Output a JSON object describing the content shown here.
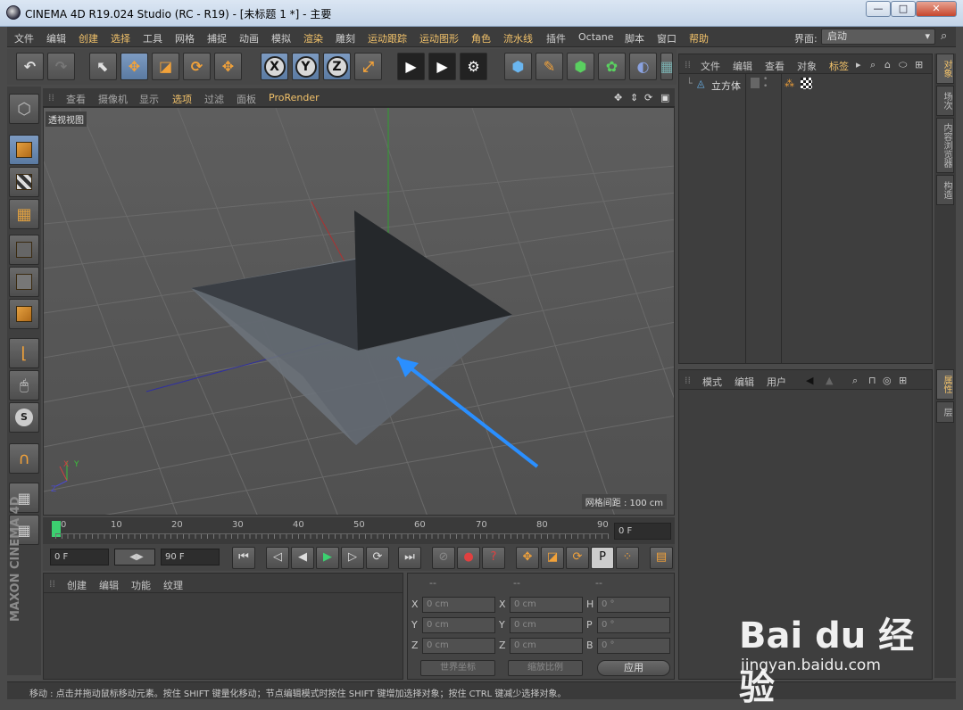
{
  "window": {
    "title": "CINEMA 4D R19.024 Studio (RC - R19) - [未标题 1 *] - 主要",
    "btn_min": "—",
    "btn_max": "□",
    "btn_close": "✕"
  },
  "menubar": {
    "items": [
      "文件",
      "编辑",
      "创建",
      "选择",
      "工具",
      "网格",
      "捕捉",
      "动画",
      "模拟",
      "渲染",
      "雕刻",
      "运动跟踪",
      "运动图形",
      "角色",
      "流水线",
      "插件",
      "Octane",
      "脚本",
      "窗口",
      "帮助"
    ],
    "layout_label": "界面:",
    "layout_value": "启动"
  },
  "viewport_menu": [
    "查看",
    "摄像机",
    "显示",
    "选项",
    "过滤",
    "面板",
    "ProRender"
  ],
  "viewport": {
    "label": "透视视图",
    "grid_info": "网格间距 : 100 cm",
    "axis_x": "X",
    "axis_y": "Y",
    "axis_z": "Z"
  },
  "timeline": {
    "ticks": [
      "0",
      "10",
      "20",
      "30",
      "40",
      "50",
      "60",
      "70",
      "80",
      "90"
    ],
    "current_frame": "0 F"
  },
  "playback": {
    "start": "0 F",
    "end": "90 F"
  },
  "material_manager": {
    "menu": [
      "创建",
      "编辑",
      "功能",
      "纹理"
    ]
  },
  "coordinates": {
    "headers": [
      "--",
      "--",
      "--"
    ],
    "row_labels": [
      "X",
      "Y",
      "Z"
    ],
    "col2_labels": [
      "X",
      "Y",
      "Z"
    ],
    "col3_labels": [
      "H",
      "P",
      "B"
    ],
    "pos_values": [
      "0 cm",
      "0 cm",
      "0 cm"
    ],
    "size_values": [
      "0 cm",
      "0 cm",
      "0 cm"
    ],
    "rot_values": [
      "0 °",
      "0 °",
      "0 °"
    ],
    "dropdown_world": "世界坐标",
    "dropdown_scale": "缩放比例",
    "apply": "应用"
  },
  "object_manager": {
    "menu": [
      "文件",
      "编辑",
      "查看",
      "对象",
      "标签"
    ],
    "object_name": "立方体"
  },
  "attribute_manager": {
    "menu": [
      "模式",
      "编辑",
      "用户"
    ]
  },
  "right_tabs": [
    "对象",
    "场次",
    "内容浏览器",
    "构造"
  ],
  "right_tabs_lower": [
    "属性",
    "层"
  ],
  "status": "移动 : 点击并拖动鼠标移动元素。按住 SHIFT 键量化移动；节点编辑模式时按住 SHIFT 键增加选择对象；按住 CTRL 键减少选择对象。",
  "watermark": {
    "brand": "Bai du 经验",
    "url": "jingyan.baidu.com"
  },
  "colors": {
    "accent": "#f2c26a",
    "selected_tool": "#5a7aa2",
    "annotation_arrow": "#2a8fff"
  }
}
